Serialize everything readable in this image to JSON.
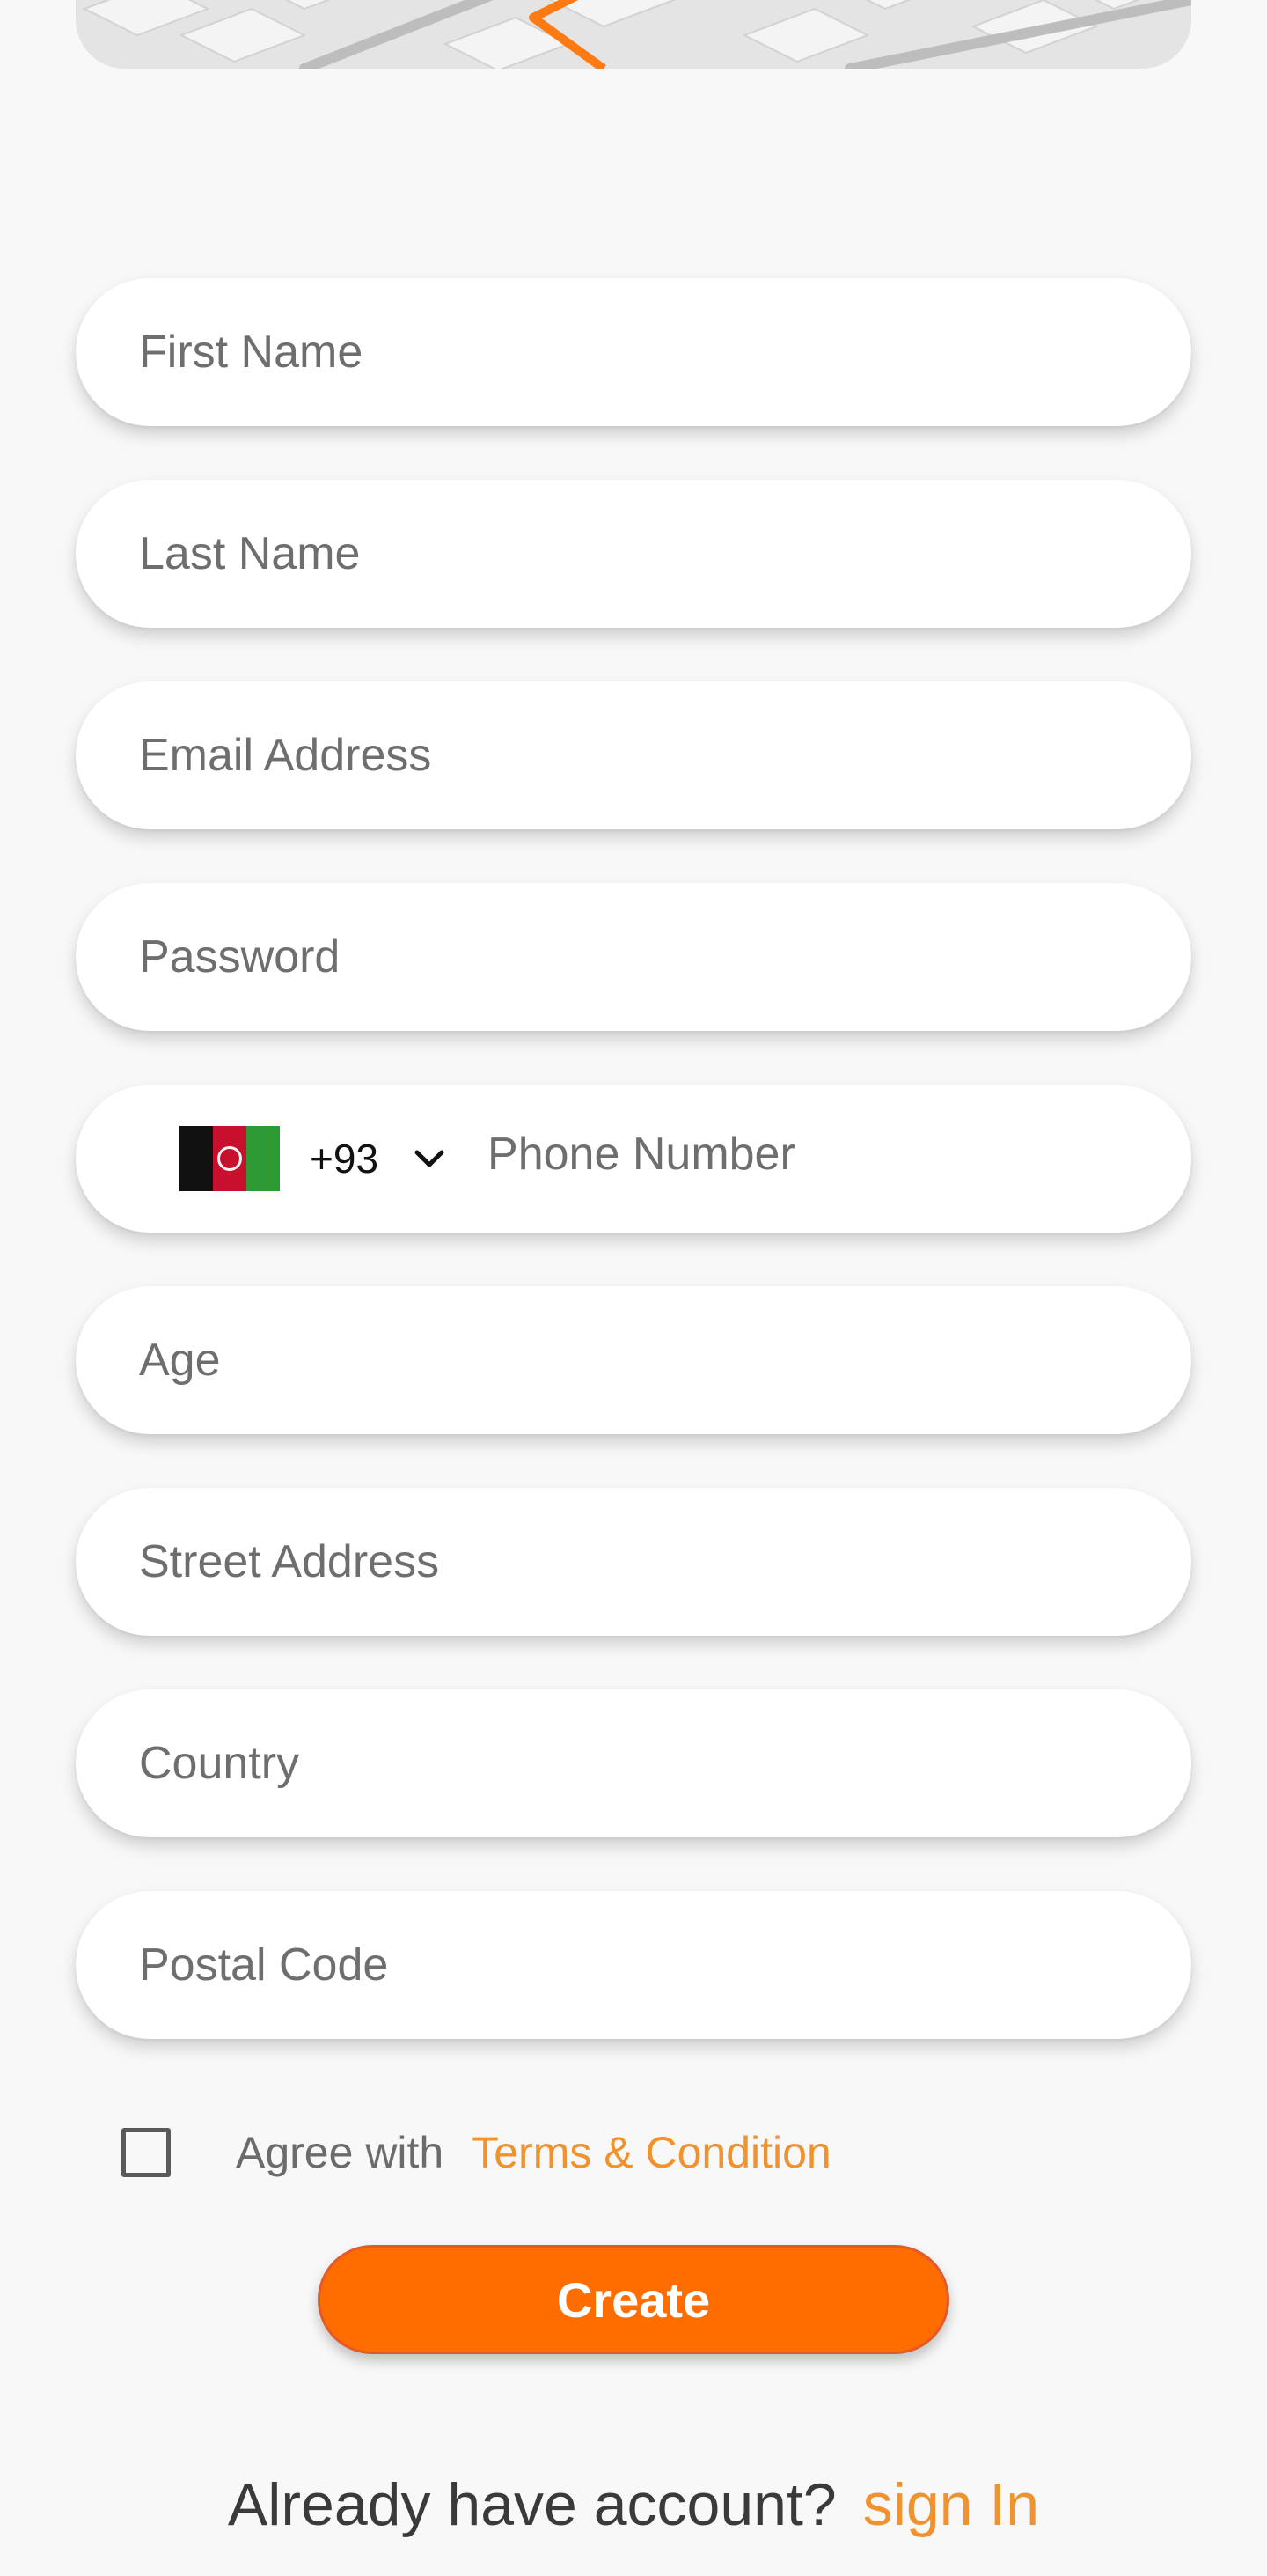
{
  "colors": {
    "accent": "#ff6d00",
    "link": "#f0922e",
    "background": "#f8f8f8",
    "field": "#ffffff"
  },
  "map": {
    "icon": "map-illustration"
  },
  "form": {
    "first_name_placeholder": "First Name",
    "last_name_placeholder": "Last Name",
    "email_placeholder": "Email Address",
    "password_placeholder": "Password",
    "phone": {
      "country_flag": "afghanistan-flag-icon",
      "dial_code": "+93",
      "placeholder": "Phone Number",
      "dropdown_icon": "chevron-down-icon"
    },
    "age_placeholder": "Age",
    "street_placeholder": "Street Address",
    "country_placeholder": "Country",
    "postal_placeholder": "Postal Code"
  },
  "terms": {
    "checked": false,
    "label": "Agree with",
    "link": "Terms & Condition"
  },
  "create_button": "Create",
  "footer": {
    "text": "Already have account?",
    "link": "sign In"
  }
}
